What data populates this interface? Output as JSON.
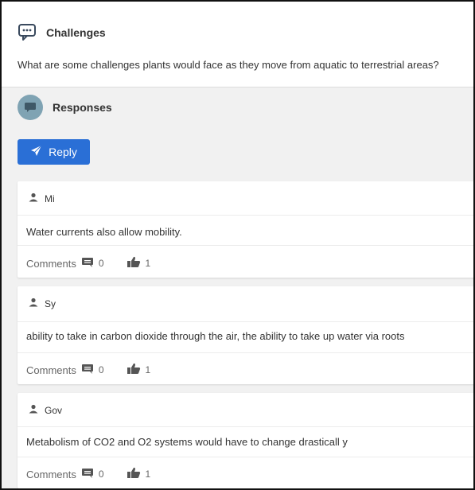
{
  "prompt": {
    "title": "Challenges",
    "question": "What are some challenges plants would face as they move from aquatic to terrestrial areas?"
  },
  "responses_section": {
    "title": "Responses",
    "reply_label": "Reply"
  },
  "responses": [
    {
      "author": "Mi",
      "text": "Water currents also allow mobility.",
      "comments_label": "Comments",
      "comment_count": "0",
      "like_count": "1"
    },
    {
      "author": "Sy",
      "text": "ability to take in carbon dioxide through the air, the ability to take up water via roots",
      "comments_label": "Comments",
      "comment_count": "0",
      "like_count": "1"
    },
    {
      "author": "Gov",
      "text": "Metabolism of CO2 and O2 systems would have to change drasticall y",
      "comments_label": "Comments",
      "comment_count": "0",
      "like_count": "1"
    }
  ],
  "colors": {
    "accent": "#2a6fd6",
    "icon_dark": "#3a4a5e",
    "avatar": "#7fa3b3"
  },
  "icons": [
    "discussion-icon",
    "chat-avatar-icon",
    "send-icon",
    "user-icon",
    "comment-icon",
    "thumbs-up-icon"
  ]
}
